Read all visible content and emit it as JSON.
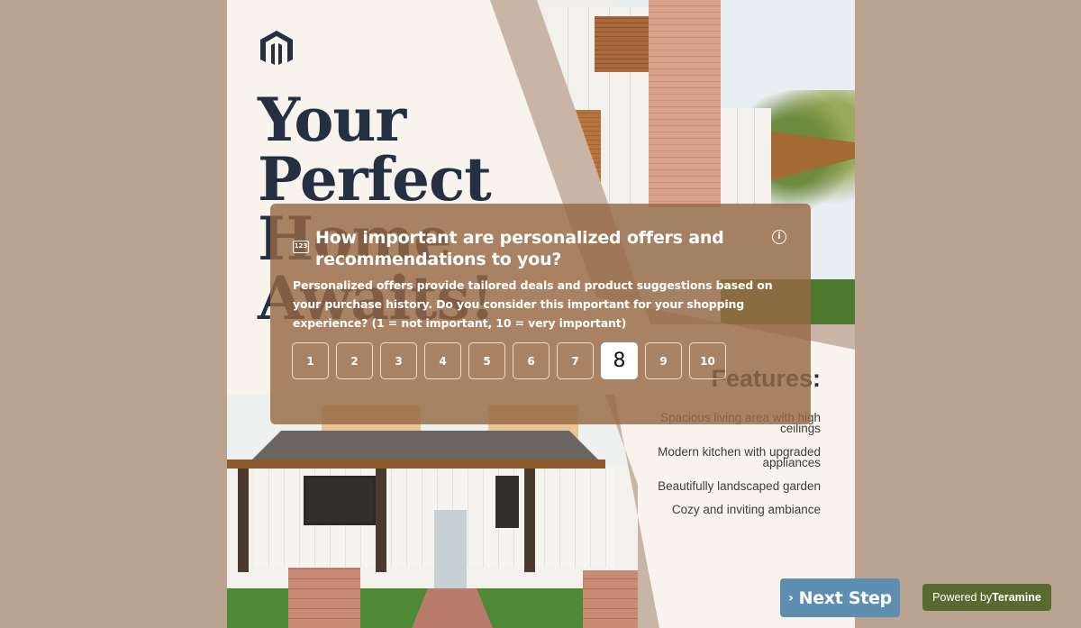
{
  "poster": {
    "logo_icon": "hexagon-m-logo",
    "headline": [
      "Your",
      "Perfect",
      "Home",
      "Awaits!"
    ],
    "features": {
      "title": "Features:",
      "items": [
        "Spacious living area with high ceilings",
        "Modern kitchen with upgraded appliances",
        "Beautifully landscaped garden",
        "Cozy and inviting ambiance"
      ]
    }
  },
  "question": {
    "type_icon": "123",
    "type_icon_name": "number-scale-icon",
    "title": "How important are personalized offers and recommendations to you?",
    "info_icon": "i",
    "description": "Personalized offers provide tailored deals and product suggestions based on your purchase history. Do you consider this important for your shopping experience? (1 = not important, 10 = very important)",
    "scale": {
      "options": [
        "1",
        "2",
        "3",
        "4",
        "5",
        "6",
        "7",
        "8",
        "9",
        "10"
      ],
      "selected": "8"
    }
  },
  "actions": {
    "next_chevron": "›",
    "next_label": "Next Step"
  },
  "branding": {
    "powered_prefix": "Powered by",
    "powered_brand": "Teramine"
  },
  "colors": {
    "page_background": "#baa391",
    "poster_background": "#f8f4ed",
    "headline": "#243041",
    "card_overlay": "#966944",
    "next_button": "#5e8fb0",
    "powered_badge": "#576b30"
  }
}
